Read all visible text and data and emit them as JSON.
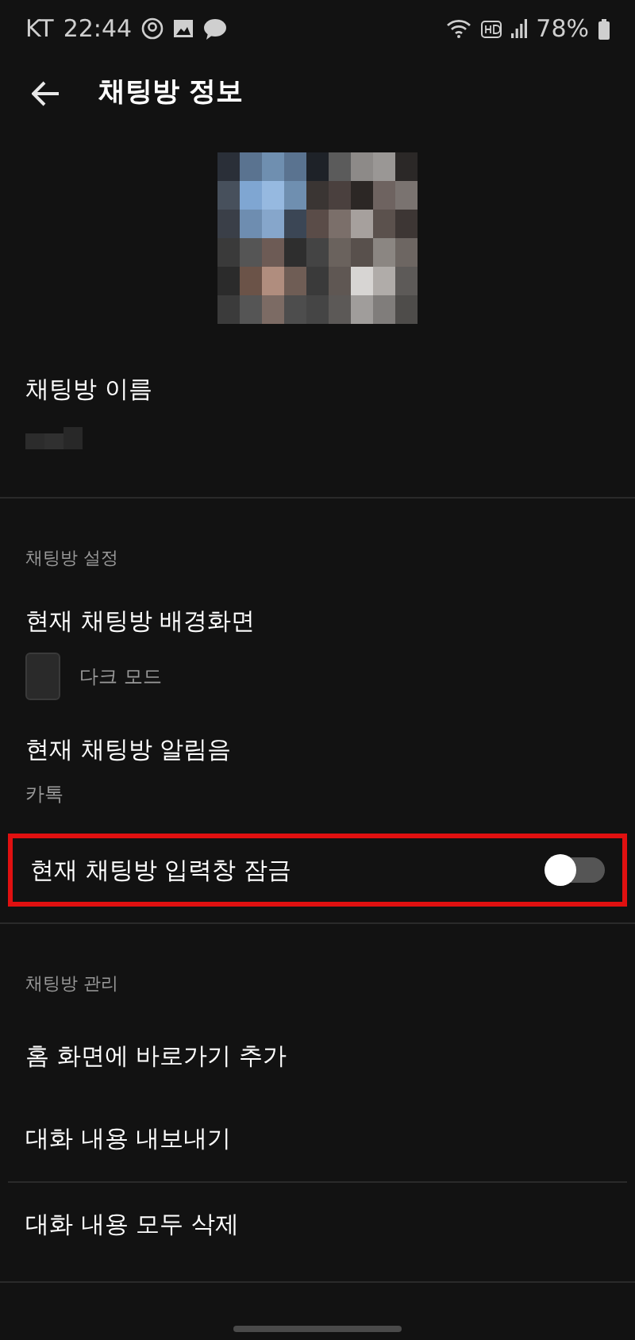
{
  "status_bar": {
    "carrier": "KT",
    "time": "22:44",
    "battery": "78%"
  },
  "header": {
    "title": "채팅방 정보"
  },
  "room_name": {
    "label": "채팅방 이름"
  },
  "sections": [
    {
      "title": "채팅방 설정",
      "items": [
        {
          "kind": "wallpaper",
          "label": "현재 채팅방 배경화면",
          "value": "다크 모드"
        },
        {
          "kind": "value",
          "label": "현재 채팅방 알림음",
          "value": "카톡"
        },
        {
          "kind": "toggle",
          "label": "현재 채팅방 입력창 잠금",
          "on": false,
          "highlighted": true
        }
      ]
    },
    {
      "title": "채팅방 관리",
      "items": [
        {
          "kind": "action",
          "label": "홈 화면에 바로가기 추가"
        },
        {
          "kind": "action",
          "label": "대화 내용 내보내기"
        },
        {
          "kind": "action",
          "label": "대화 내용 모두 삭제"
        }
      ]
    }
  ]
}
